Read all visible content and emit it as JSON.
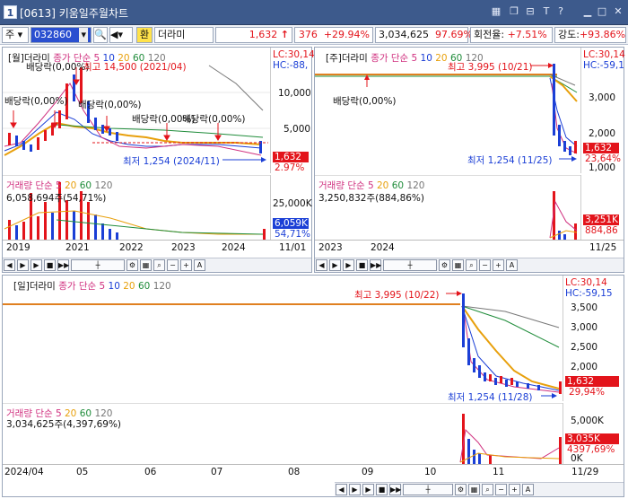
{
  "window": {
    "number": "1",
    "title": "[0613] 키움일주월차트"
  },
  "toolbar": {
    "market": "주",
    "code": "032860",
    "search_icon": "search-icon",
    "favorite": "환",
    "name": "더라미",
    "price": "1,632",
    "change": "376",
    "change_rate": "+29.94%",
    "volume": "3,034,625",
    "volume_rate": "97.69%",
    "turnover_label": "회전율:",
    "turnover": "+7.51%",
    "strength_label": "강도:",
    "strength": "+93.86%"
  },
  "monthly": {
    "header": "[월]더라미",
    "ma_label": "종가 단순 5",
    "ma_periods": [
      "10",
      "20",
      "60",
      "120"
    ],
    "lc": "LC:30,14",
    "hc": "HC:-88,",
    "price_ticks": [
      "10,000",
      "5,000"
    ],
    "price_tag": "1,632",
    "pct_tag": "2.97%",
    "high_note": "최고 14,500 (2021/04)",
    "low_note": "최저 1,254 (2024/11)",
    "dividend_notes": [
      "배당락(0,00%)",
      "배당락(0,00%)",
      "배당락(0,00%)",
      "배당락(0,00%)",
      "배당락(0,00%)"
    ],
    "vol_label": "거래량 단순 5",
    "vol_periods": [
      "20",
      "60",
      "120"
    ],
    "vol_value": "6,058,694주(54,71%)",
    "vol_tick": "25,000K",
    "vol_tag": "6,059K",
    "vol_pct": "54,71%",
    "dates": [
      "2019",
      "2021",
      "2022",
      "2023",
      "2024"
    ],
    "date_end": "11/01"
  },
  "weekly": {
    "header": "[주]더라미",
    "ma_label": "종가 단순 5",
    "ma_periods": [
      "10",
      "20",
      "60",
      "120"
    ],
    "lc": "LC:30,14",
    "hc": "HC:-59,1",
    "price_ticks": [
      "3,000",
      "2,000",
      "1,000"
    ],
    "price_tag": "1,632",
    "pct_tag": "23,64%",
    "high_note": "최고 3,995 (10/21)",
    "low_note": "최저 1,254 (11/25)",
    "dividend_note": "배당락(0,00%)",
    "vol_label": "거래량 단순 5",
    "vol_periods": [
      "20",
      "60",
      "120"
    ],
    "vol_value": "3,250,832주(884,86%)",
    "vol_tag": "3,251K",
    "vol_pct": "884,86",
    "dates": [
      "2023",
      "2024"
    ],
    "date_end": "11/25"
  },
  "daily": {
    "header": "[일]더라미",
    "ma_label": "종가 단순 5",
    "ma_periods": [
      "10",
      "20",
      "60",
      "120"
    ],
    "lc": "LC:30,14",
    "hc": "HC:-59,15",
    "price_ticks": [
      "3,500",
      "3,000",
      "2,500",
      "2,000",
      "1,500"
    ],
    "price_tag": "1,632",
    "pct_tag": "29,94%",
    "high_note": "최고 3,995 (10/22)",
    "low_note": "최저 1,254 (11/28)",
    "vol_label": "거래량 단순 5",
    "vol_periods": [
      "20",
      "60",
      "120"
    ],
    "vol_value": "3,034,625주(4,397,69%)",
    "vol_ticks": [
      "5,000K",
      "0K"
    ],
    "vol_tag": "3,035K",
    "vol_pct": "4397,69%",
    "dates": [
      "2024/04",
      "05",
      "06",
      "07",
      "08",
      "09",
      "10",
      "11"
    ],
    "date_end": "11/29"
  },
  "colors": {
    "up": "#e3141b",
    "down": "#1b3fd6",
    "ma5": "#d0307f",
    "ma10": "#1b3fd6",
    "ma20": "#e8a00c",
    "ma60": "#1f8c3a",
    "ma120": "#777777"
  }
}
